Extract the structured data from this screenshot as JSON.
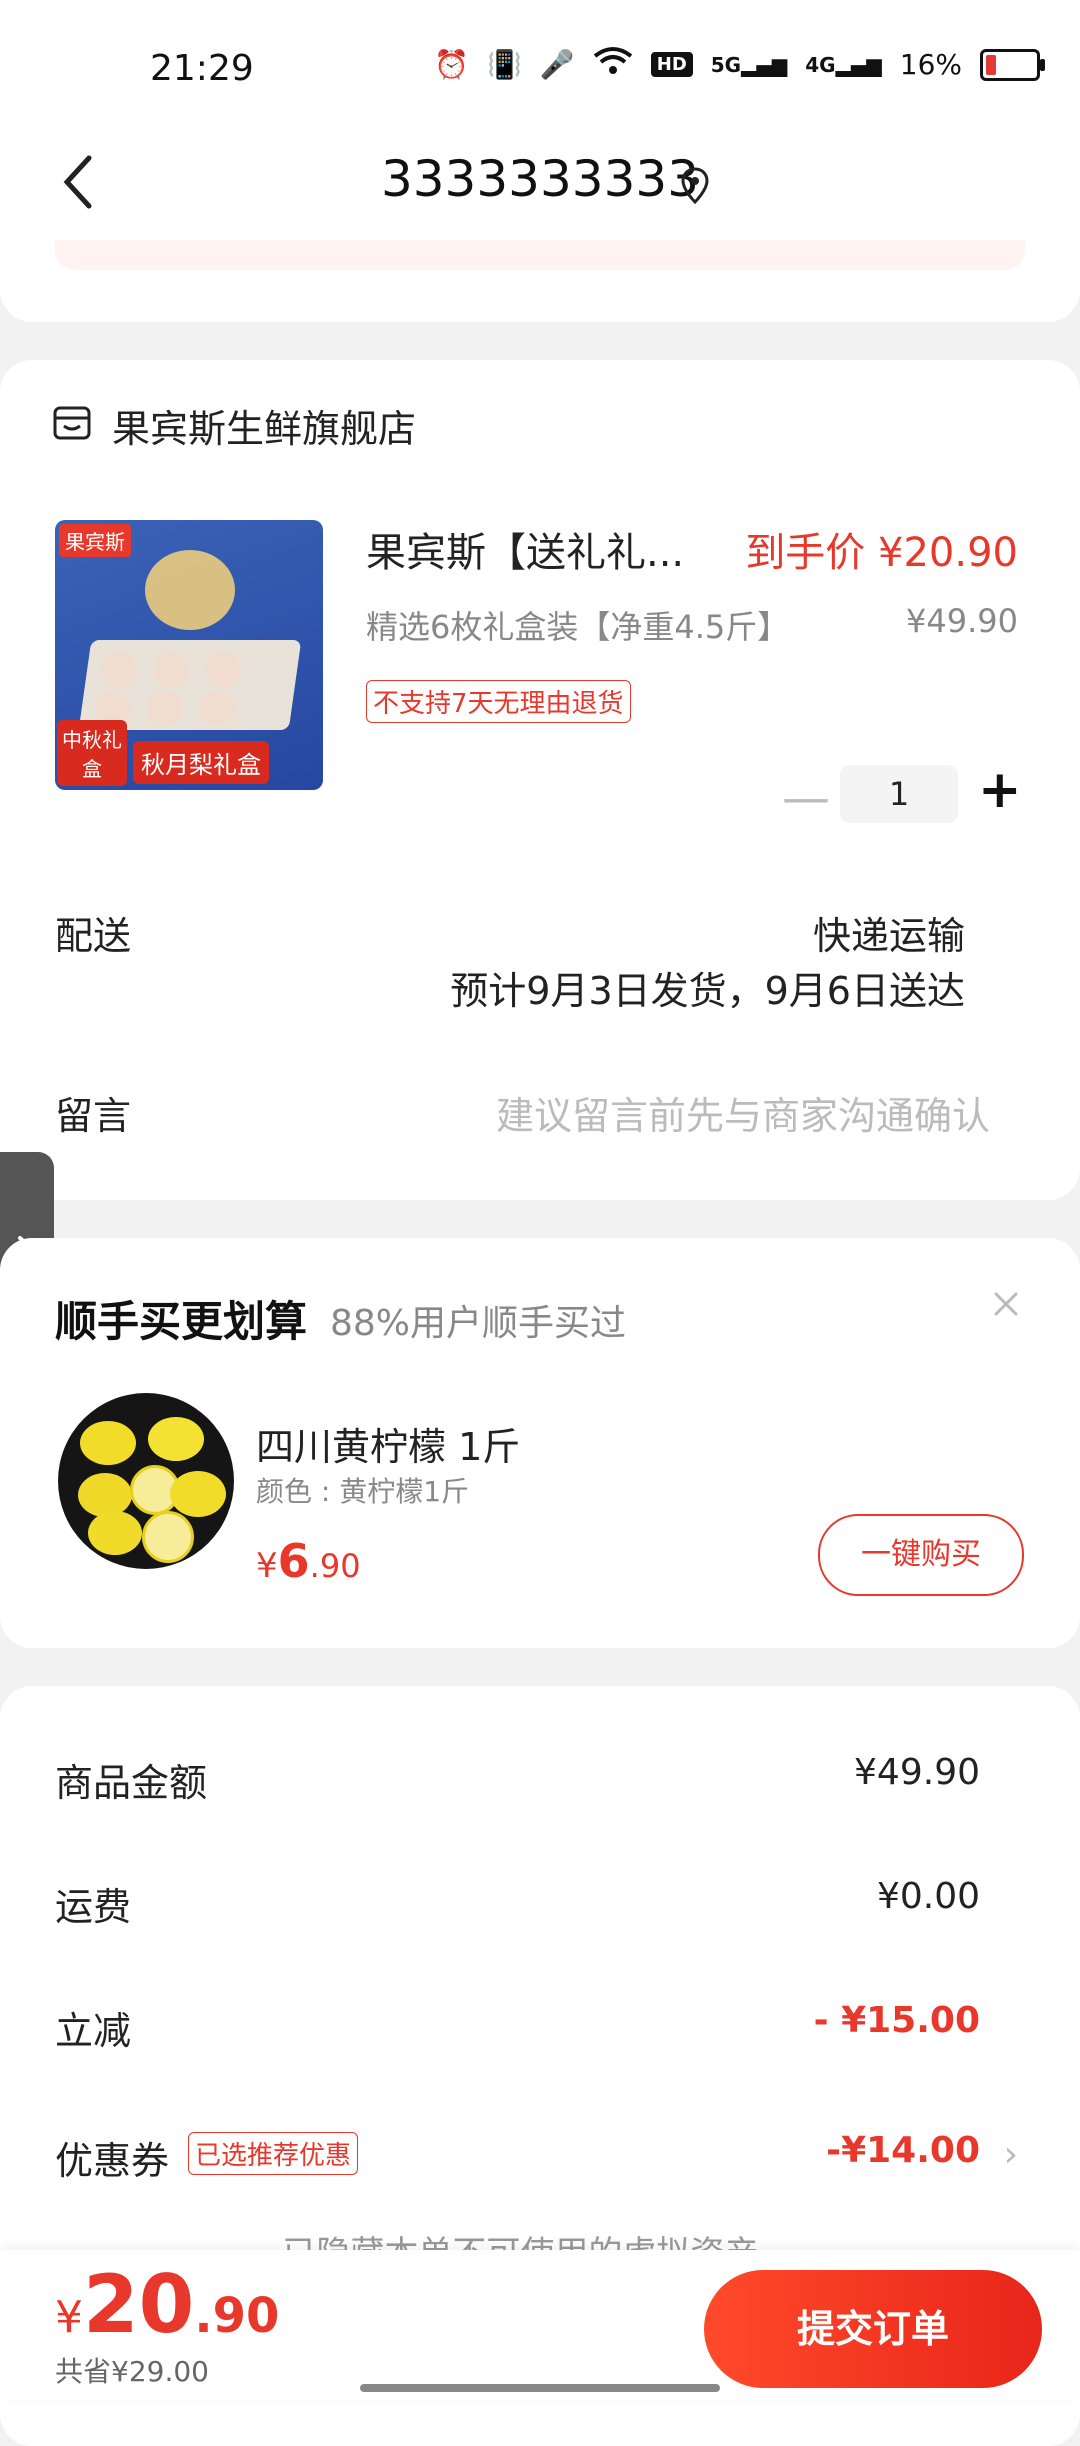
{
  "status": {
    "time": "21:29",
    "battery": "16%",
    "net1": "5G",
    "net2": "4G",
    "hd": "HD"
  },
  "header": {
    "title": "3333333333"
  },
  "shop": {
    "name": "果宾斯生鲜旗舰店"
  },
  "product": {
    "name": "果宾斯【送礼礼...",
    "final_price": "到手价 ¥20.90",
    "spec": "精选6枚礼盒装【净重4.5斤】",
    "orig_price": "¥49.90",
    "tag": "不支持7天无理由退货",
    "qty": "1",
    "img_brand": "果宾斯",
    "img_label1": "中秋礼盒",
    "img_label2": "秋月梨礼盒"
  },
  "delivery": {
    "label": "配送",
    "method": "快递运输",
    "estimate": "预计9月3日发货，9月6日送达"
  },
  "memo": {
    "label": "留言",
    "placeholder": "建议留言前先与商家沟通确认"
  },
  "upsell": {
    "title": "顺手买更划算",
    "subtitle": "88%用户顺手买过",
    "item_name": "四川黄柠檬 1斤",
    "item_color": "颜色 : 黄柠檬1斤",
    "price_currency": "¥",
    "price_int": "6",
    "price_dec": ".90",
    "buy_label": "一键购买"
  },
  "summary": {
    "goods_label": "商品金额",
    "goods_value": "¥49.90",
    "freight_label": "运费",
    "freight_value": "¥0.00",
    "discount_label": "立减",
    "discount_value": "- ¥15.00",
    "coupon_label": "优惠券",
    "coupon_tag": "已选推荐优惠",
    "coupon_value": "-¥14.00",
    "hidden_note": "已隐藏本单不可使用的虚拟资产"
  },
  "footer": {
    "total_currency": "¥",
    "total_int": "20",
    "total_dec": ".90",
    "saved": "共省¥29.00",
    "submit_label": "提交订单"
  },
  "colors": {
    "accent": "#e8382c"
  }
}
